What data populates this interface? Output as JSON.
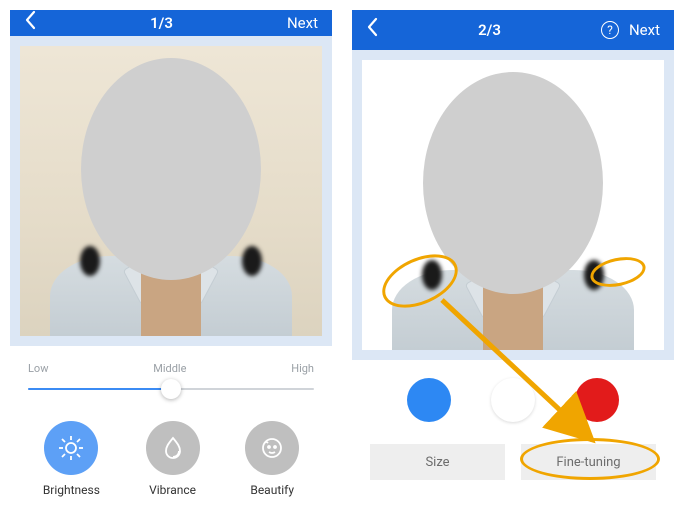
{
  "screen1": {
    "step": "1/3",
    "next": "Next",
    "slider": {
      "low": "Low",
      "middle": "Middle",
      "high": "High",
      "value_pct": 50
    },
    "adjustments": {
      "brightness": "Brightness",
      "vibrance": "Vibrance",
      "beautify": "Beautify"
    }
  },
  "screen2": {
    "step": "2/3",
    "next": "Next",
    "colors": {
      "blue": "#2d88f3",
      "white": "#ffffff",
      "red": "#e21b1b"
    },
    "buttons": {
      "size": "Size",
      "fine_tuning": "Fine-tuning"
    }
  },
  "annotation_arrow_label": ""
}
